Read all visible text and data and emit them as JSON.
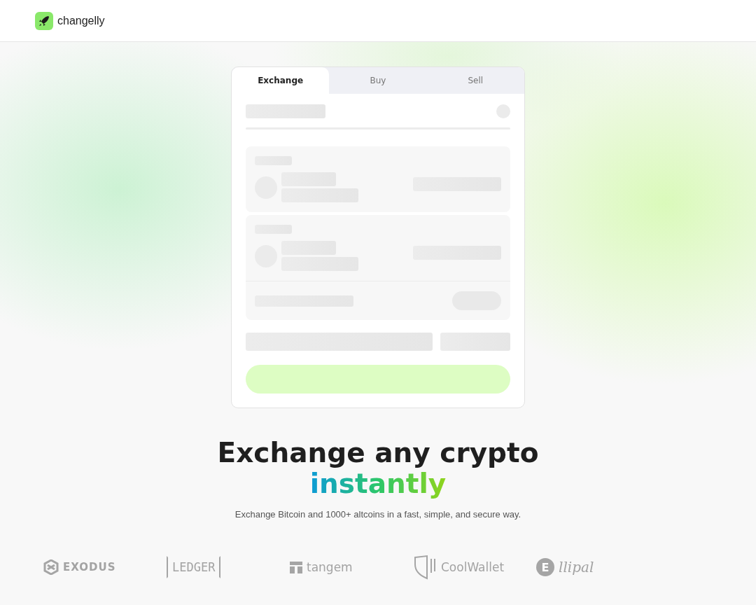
{
  "header": {
    "logo": "changelly"
  },
  "tabs": [
    {
      "label": "Exchange",
      "selected": true
    },
    {
      "label": "Buy",
      "selected": false
    },
    {
      "label": "Sell",
      "selected": false
    }
  ],
  "headline": {
    "line_1": "Exchange any crypto",
    "line_2": "instantly"
  },
  "subtitle": "Exchange Bitcoin and 1000+ altcoins in a fast, simple, and secure way.",
  "partners": [
    {
      "kind": "exodus",
      "name": "EXODUS"
    },
    {
      "kind": "ledger",
      "name": "LEDGER"
    },
    {
      "kind": "tangem",
      "name": "tangem"
    },
    {
      "kind": "coolwallet",
      "name": "CoolWallet"
    },
    {
      "kind": "ellipal",
      "mark": "E",
      "name": "llipal"
    }
  ]
}
